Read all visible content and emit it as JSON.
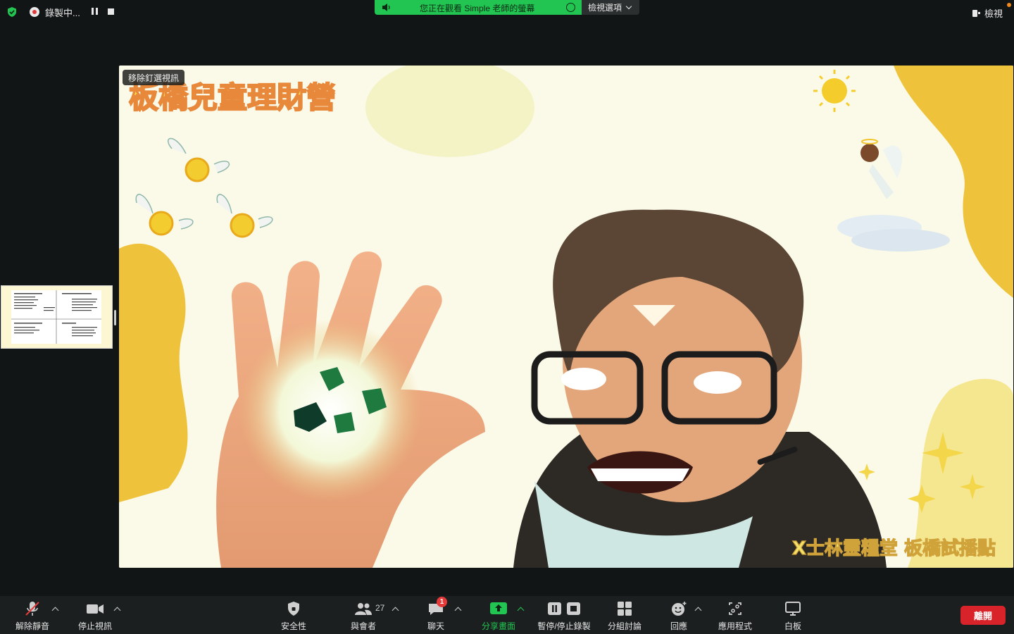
{
  "topbar": {
    "recording_label": "錄製中...",
    "viewing_banner": "您正在觀看 Simple 老師的螢幕",
    "view_options_label": "檢視選項",
    "view_label": "檢視"
  },
  "main_video": {
    "pin_label": "移除釘選視訊",
    "title_text": "板橋兒童理財營",
    "footer_text": "X士林靈糧堂 板橋試播點"
  },
  "toolbar": {
    "unmute_label": "解除靜音",
    "stop_video_label": "停止視訊",
    "security_label": "安全性",
    "participants_label": "與會者",
    "participants_count": "27",
    "chat_label": "聊天",
    "chat_badge": "1",
    "share_label": "分享畫面",
    "pause_stop_record_label": "暫停/停止錄製",
    "breakout_label": "分組討論",
    "reactions_label": "回應",
    "apps_label": "應用程式",
    "whiteboard_label": "白板",
    "leave_label": "離開"
  },
  "colors": {
    "share_green": "#23c552",
    "leave_red": "#d9232a",
    "background_yellow": "#f2cc3c"
  }
}
